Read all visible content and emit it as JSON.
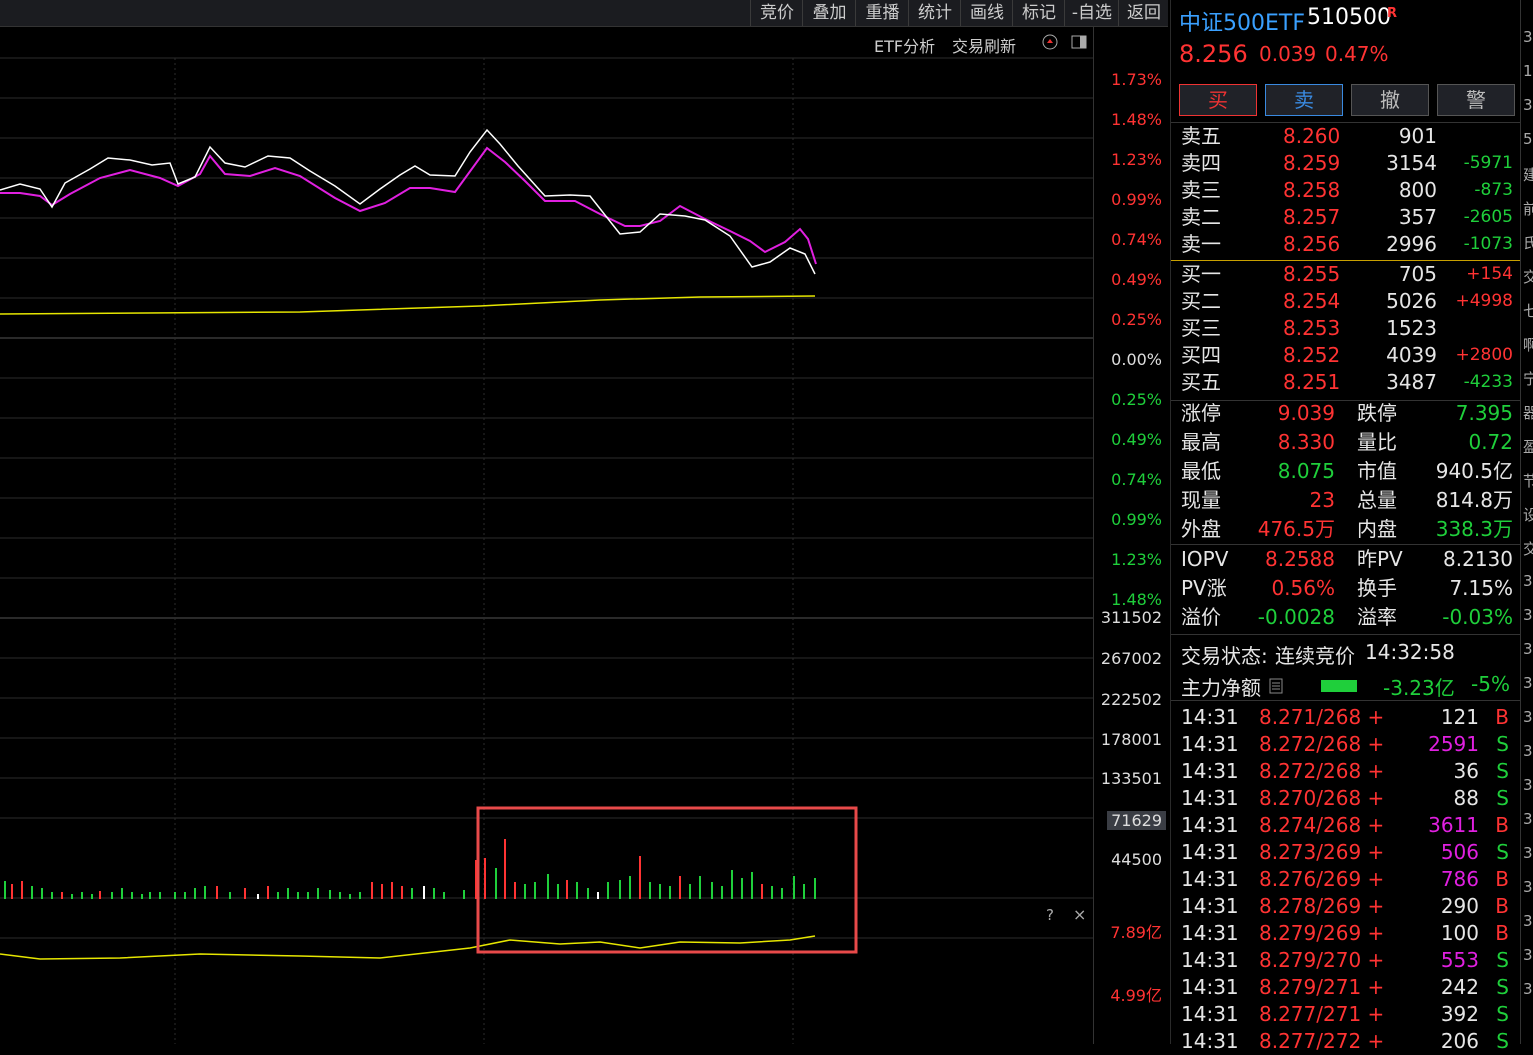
{
  "menubar": {
    "items": [
      "竞价",
      "叠加",
      "重播",
      "统计",
      "画线",
      "标记",
      "-自选",
      "返回"
    ]
  },
  "subbar": {
    "etf_analysis": "ETF分析",
    "trade_refresh": "交易刷新"
  },
  "axis": {
    "price_pct": [
      "1.73%",
      "1.48%",
      "1.23%",
      "0.99%",
      "0.74%",
      "0.49%",
      "0.25%",
      "0.00%",
      "0.25%",
      "0.49%",
      "0.74%",
      "0.99%",
      "1.23%",
      "1.48%"
    ],
    "volume": [
      "311502",
      "267002",
      "222502",
      "178001",
      "133501",
      "71629",
      "44500"
    ],
    "amount": [
      "7.89亿",
      "4.99亿"
    ]
  },
  "chart_controls": {
    "help": "?",
    "close": "×"
  },
  "quote": {
    "name": "中证500ETF",
    "code": "510500",
    "flag": "R",
    "price": "8.256",
    "change": "0.039",
    "change_pct": "0.47%"
  },
  "buttons": {
    "buy": "买",
    "sell": "卖",
    "cancel": "撤",
    "alert": "警"
  },
  "sell_orders": [
    {
      "label": "卖五",
      "price": "8.260",
      "vol": "901",
      "delta": ""
    },
    {
      "label": "卖四",
      "price": "8.259",
      "vol": "3154",
      "delta": "-5971"
    },
    {
      "label": "卖三",
      "price": "8.258",
      "vol": "800",
      "delta": "-873"
    },
    {
      "label": "卖二",
      "price": "8.257",
      "vol": "357",
      "delta": "-2605"
    },
    {
      "label": "卖一",
      "price": "8.256",
      "vol": "2996",
      "delta": "-1073"
    }
  ],
  "buy_orders": [
    {
      "label": "买一",
      "price": "8.255",
      "vol": "705",
      "delta": "+154"
    },
    {
      "label": "买二",
      "price": "8.254",
      "vol": "5026",
      "delta": "+4998"
    },
    {
      "label": "买三",
      "price": "8.253",
      "vol": "1523",
      "delta": ""
    },
    {
      "label": "买四",
      "price": "8.252",
      "vol": "4039",
      "delta": "+2800"
    },
    {
      "label": "买五",
      "price": "8.251",
      "vol": "3487",
      "delta": "-4233"
    }
  ],
  "stats": [
    {
      "l1": "涨停",
      "v1": "9.039",
      "l2": "跌停",
      "v2": "7.395"
    },
    {
      "l1": "最高",
      "v1": "8.330",
      "l2": "量比",
      "v2": "0.72"
    },
    {
      "l1": "最低",
      "v1": "8.075",
      "l2": "市值",
      "v2": "940.5亿"
    },
    {
      "l1": "现量",
      "v1": "23",
      "l2": "总量",
      "v2": "814.8万"
    },
    {
      "l1": "外盘",
      "v1": "476.5万",
      "l2": "内盘",
      "v2": "338.3万"
    }
  ],
  "iopv": [
    {
      "l1": "IOPV",
      "v1": "8.2588",
      "l2": "昨PV",
      "v2": "8.2130"
    },
    {
      "l1": "PV涨",
      "v1": "0.56%",
      "l2": "换手",
      "v2": "7.15%"
    },
    {
      "l1": "溢价",
      "v1": "-0.0028",
      "l2": "溢率",
      "v2": "-0.03%"
    }
  ],
  "status": {
    "label": "交易状态:",
    "value": "连续竞价",
    "time": "14:32:58"
  },
  "main_flow": {
    "label": "主力净额",
    "value": "-3.23亿",
    "pct": "-5%"
  },
  "ticks": [
    {
      "time": "14:31",
      "price": "8.271/268 +",
      "vol": "121",
      "side": "B",
      "vc": "w"
    },
    {
      "time": "14:31",
      "price": "8.272/268 +",
      "vol": "2591",
      "side": "S",
      "vc": "m"
    },
    {
      "time": "14:31",
      "price": "8.272/268 +",
      "vol": "36",
      "side": "S",
      "vc": "w"
    },
    {
      "time": "14:31",
      "price": "8.270/268 +",
      "vol": "88",
      "side": "S",
      "vc": "w"
    },
    {
      "time": "14:31",
      "price": "8.274/268 +",
      "vol": "3611",
      "side": "B",
      "vc": "m"
    },
    {
      "time": "14:31",
      "price": "8.273/269 +",
      "vol": "506",
      "side": "S",
      "vc": "m"
    },
    {
      "time": "14:31",
      "price": "8.276/269 +",
      "vol": "786",
      "side": "B",
      "vc": "m"
    },
    {
      "time": "14:31",
      "price": "8.278/269 +",
      "vol": "290",
      "side": "B",
      "vc": "w"
    },
    {
      "time": "14:31",
      "price": "8.279/269 +",
      "vol": "100",
      "side": "B",
      "vc": "w"
    },
    {
      "time": "14:31",
      "price": "8.279/270 +",
      "vol": "553",
      "side": "S",
      "vc": "m"
    },
    {
      "time": "14:31",
      "price": "8.279/271 +",
      "vol": "242",
      "side": "S",
      "vc": "w"
    },
    {
      "time": "14:31",
      "price": "8.277/271 +",
      "vol": "392",
      "side": "S",
      "vc": "w"
    },
    {
      "time": "14:31",
      "price": "8.277/272 +",
      "vol": "206",
      "side": "S",
      "vc": "w"
    }
  ],
  "edge_text": [
    "3",
    "1",
    "3",
    "5",
    "建",
    "前",
    "氏",
    "交",
    "七",
    "啊",
    "宁",
    "器",
    "盈",
    "节",
    "设",
    "交",
    "3",
    "3",
    "3",
    "3",
    "3",
    "3",
    "3",
    "3",
    "3",
    "3",
    "3",
    "3",
    "3"
  ],
  "colors": {
    "price_line": "#ffffff",
    "avg_line": "#e020e0",
    "amount_line": "#ffff00",
    "up": "#ff3333",
    "down": "#1fcf3b",
    "highlight": "#e84a4a"
  }
}
